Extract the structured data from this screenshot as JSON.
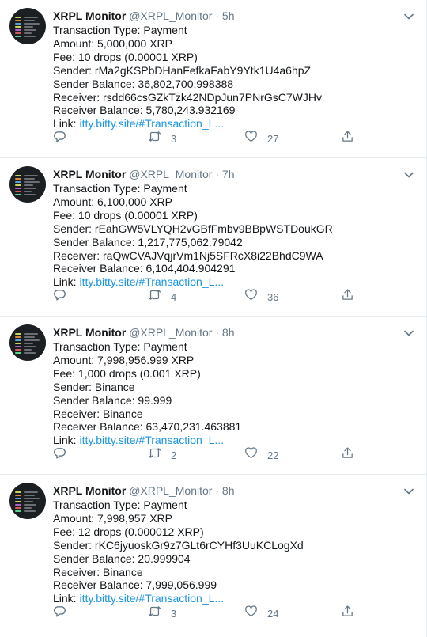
{
  "tweets": [
    {
      "name": "XRPL Monitor",
      "handle": "@XRPL_Monitor",
      "separator": "·",
      "time": "5h",
      "lines": [
        "Transaction Type: Payment",
        "Amount: 5,000,000 XRP",
        "Fee: 10 drops (0.00001 XRP)",
        "Sender: rMa2gKSPbDHanFefkaFabY9Ytk1U4a6hpZ",
        "Sender Balance: 36,802,700.998388",
        "Receiver: rsdd66csGZkTzk42NDpJun7PNrGsC7WJHv",
        "Receiver Balance: 5,780,243.932169"
      ],
      "link_prefix": "Link: ",
      "link_text": "itty.bitty.site/#Transaction_L...",
      "retweets": "3",
      "likes": "27"
    },
    {
      "name": "XRPL Monitor",
      "handle": "@XRPL_Monitor",
      "separator": "·",
      "time": "7h",
      "lines": [
        "Transaction Type: Payment",
        "Amount: 6,100,000 XRP",
        "Fee: 10 drops (0.00001 XRP)",
        "Sender: rEahGW5VLYQH2vGBfFmbv9BBpWSTDoukGR",
        "Sender Balance: 1,217,775,062.79042",
        "Receiver: raQwCVAJVqjrVm1Nj5SFRcX8i22BhdC9WA",
        "Receiver Balance: 6,104,404.904291"
      ],
      "link_prefix": "Link: ",
      "link_text": "itty.bitty.site/#Transaction_L...",
      "retweets": "4",
      "likes": "36"
    },
    {
      "name": "XRPL Monitor",
      "handle": "@XRPL_Monitor",
      "separator": "·",
      "time": "8h",
      "lines": [
        "Transaction Type: Payment",
        "Amount: 7,998,956.999 XRP",
        "Fee: 1,000 drops (0.001 XRP)",
        "Sender: Binance",
        "Sender Balance: 99.999",
        "Receiver: Binance",
        "Receiver Balance: 63,470,231.463881"
      ],
      "link_prefix": "Link: ",
      "link_text": "itty.bitty.site/#Transaction_L...",
      "retweets": "2",
      "likes": "22"
    },
    {
      "name": "XRPL Monitor",
      "handle": "@XRPL_Monitor",
      "separator": "·",
      "time": "8h",
      "lines": [
        "Transaction Type: Payment",
        "Amount: 7,998,957 XRP",
        "Fee: 12 drops (0.000012 XRP)",
        "Sender: rKC6jyuoskGr9z7GLt6rCYHf3UuKCLogXd",
        "Sender Balance: 20.999904",
        "Receiver: Binance",
        "Receiver Balance: 7,999,056.999"
      ],
      "link_prefix": "Link: ",
      "link_text": "itty.bitty.site/#Transaction_L...",
      "retweets": "3",
      "likes": "24"
    }
  ],
  "icons": {
    "reply": "reply-icon",
    "retweet": "retweet-icon",
    "like": "like-icon",
    "share": "share-icon",
    "caret": "chevron-down-icon"
  },
  "colors": {
    "link": "#1b95e0",
    "secondary_text": "#657786",
    "primary_text": "#14171a",
    "divider": "#e6ecf0",
    "avatar_bg": "#1b1f22"
  }
}
